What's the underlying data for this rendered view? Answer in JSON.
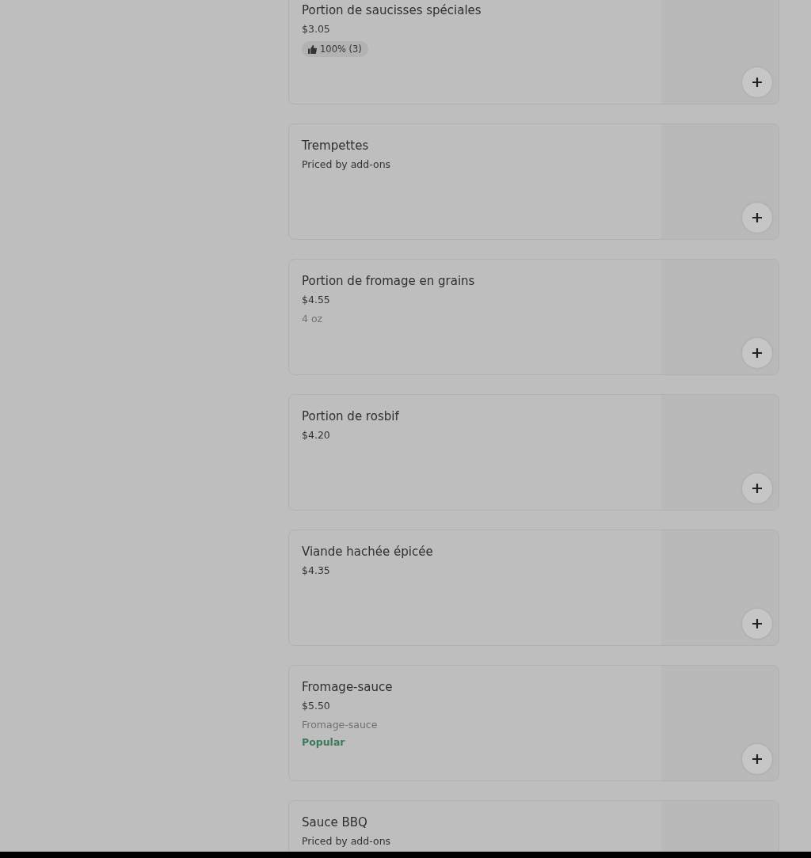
{
  "items": [
    {
      "name": "Portion de saucisses spéciales",
      "price": "$3.05",
      "rating": "100% (3)"
    },
    {
      "name": "Trempettes",
      "price": "Priced by add-ons"
    },
    {
      "name": "Portion de fromage en grains",
      "price": "$4.55",
      "description": "4 oz"
    },
    {
      "name": "Portion de rosbif",
      "price": "$4.20"
    },
    {
      "name": "Viande hachée épicée",
      "price": "$4.35"
    },
    {
      "name": "Fromage-sauce",
      "price": "$5.50",
      "description": "Fromage-sauce",
      "tag": "Popular"
    },
    {
      "name": "Sauce BBQ",
      "price": "Priced by add-ons"
    }
  ]
}
